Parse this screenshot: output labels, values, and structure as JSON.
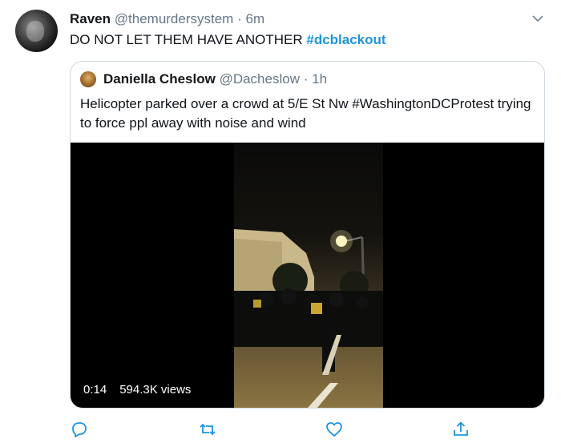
{
  "tweet": {
    "author_name": "Raven",
    "author_handle": "@themurdersystem",
    "separator": "·",
    "time": "6m",
    "text": "DO NOT LET THEM HAVE ANOTHER",
    "hashtag": "#dcblackout"
  },
  "quoted": {
    "author_name": "Daniella Cheslow",
    "author_handle": "@Dacheslow",
    "separator": "·",
    "time": "1h",
    "text": "Helicopter parked over a crowd at 5/E St Nw #WashingtonDCProtest trying to force ppl away with noise and wind",
    "video": {
      "duration": "0:14",
      "views": "594.3K views"
    }
  },
  "actions": {
    "icons": [
      "reply-icon",
      "retweet-icon",
      "like-icon",
      "share-icon"
    ]
  },
  "colors": {
    "accent": "#1b95e0",
    "muted": "#657786",
    "border": "#cfd9de"
  }
}
